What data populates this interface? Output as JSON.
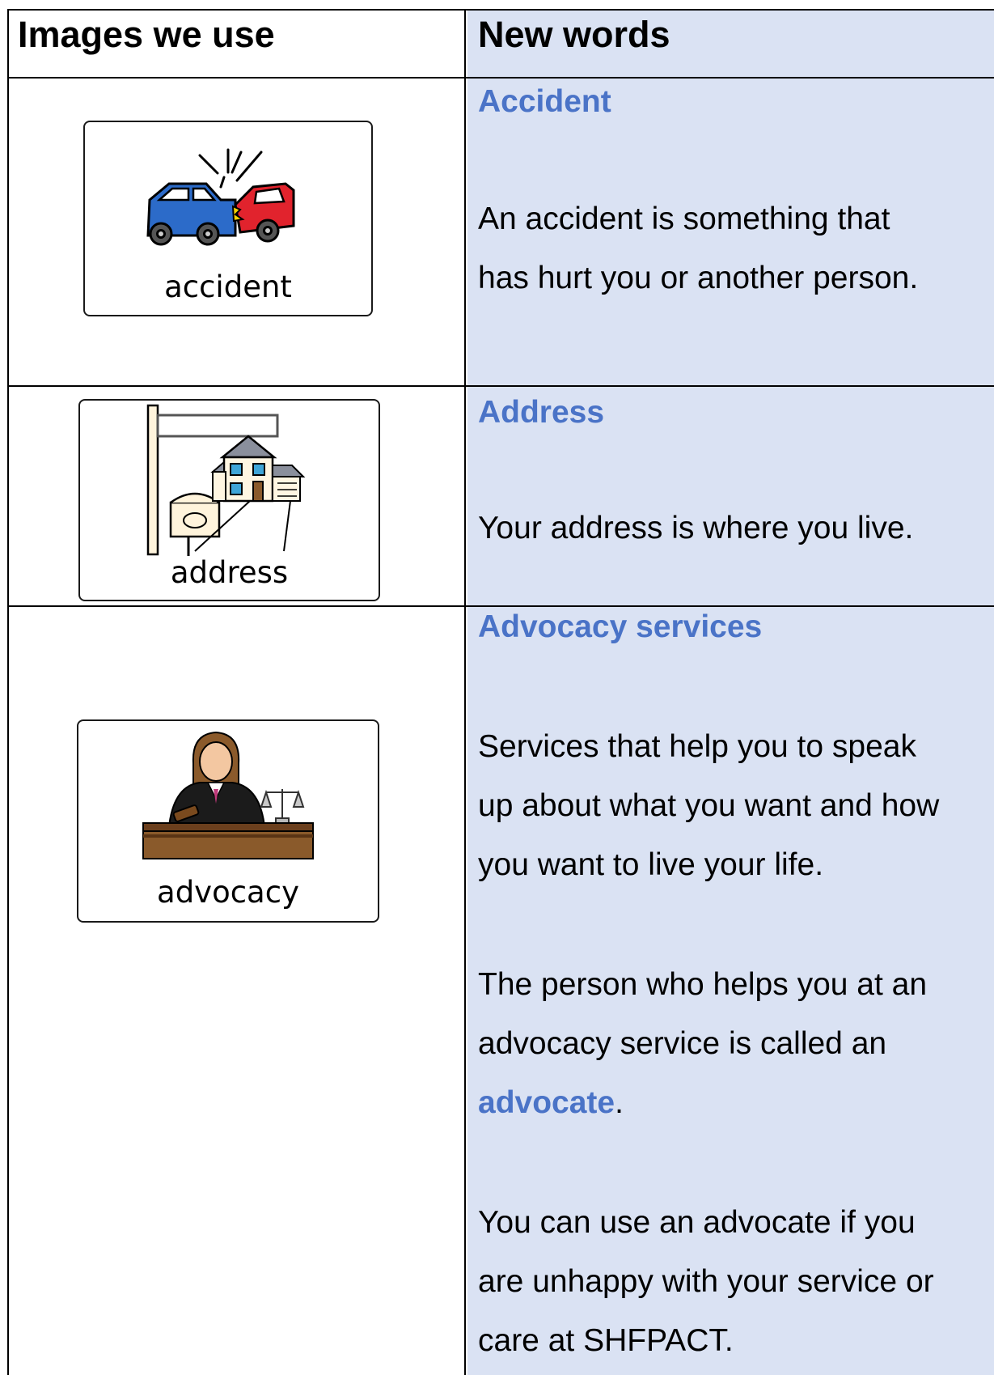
{
  "header": {
    "images_col": "Images we use",
    "words_col": "New words"
  },
  "rows": [
    {
      "term": "Accident",
      "image_label": "accident",
      "image_icon": "car-accident-icon",
      "definition": [
        "An accident is something that",
        "has hurt you or another person."
      ]
    },
    {
      "term": "Address",
      "image_label": "address",
      "image_icon": "house-address-icon",
      "definition": [
        "Your address is where you live."
      ]
    },
    {
      "term": "Advocacy services",
      "image_label": "advocacy",
      "image_icon": "judge-advocacy-icon",
      "definition": [
        "Services that help you to speak",
        "up about what you want and how",
        "you want to live your life."
      ],
      "definition2": [
        "The person who helps you at an",
        "advocacy service is called an"
      ],
      "advocate_term": "advocate",
      "advocate_period": ".",
      "definition3": [
        "You can use an advocate if you",
        "are unhappy with your service or",
        "care at SHFPACT."
      ]
    }
  ],
  "colors": {
    "words_column_bg": "#dae2f3",
    "term_color": "#4a73c7",
    "border": "#000000"
  }
}
